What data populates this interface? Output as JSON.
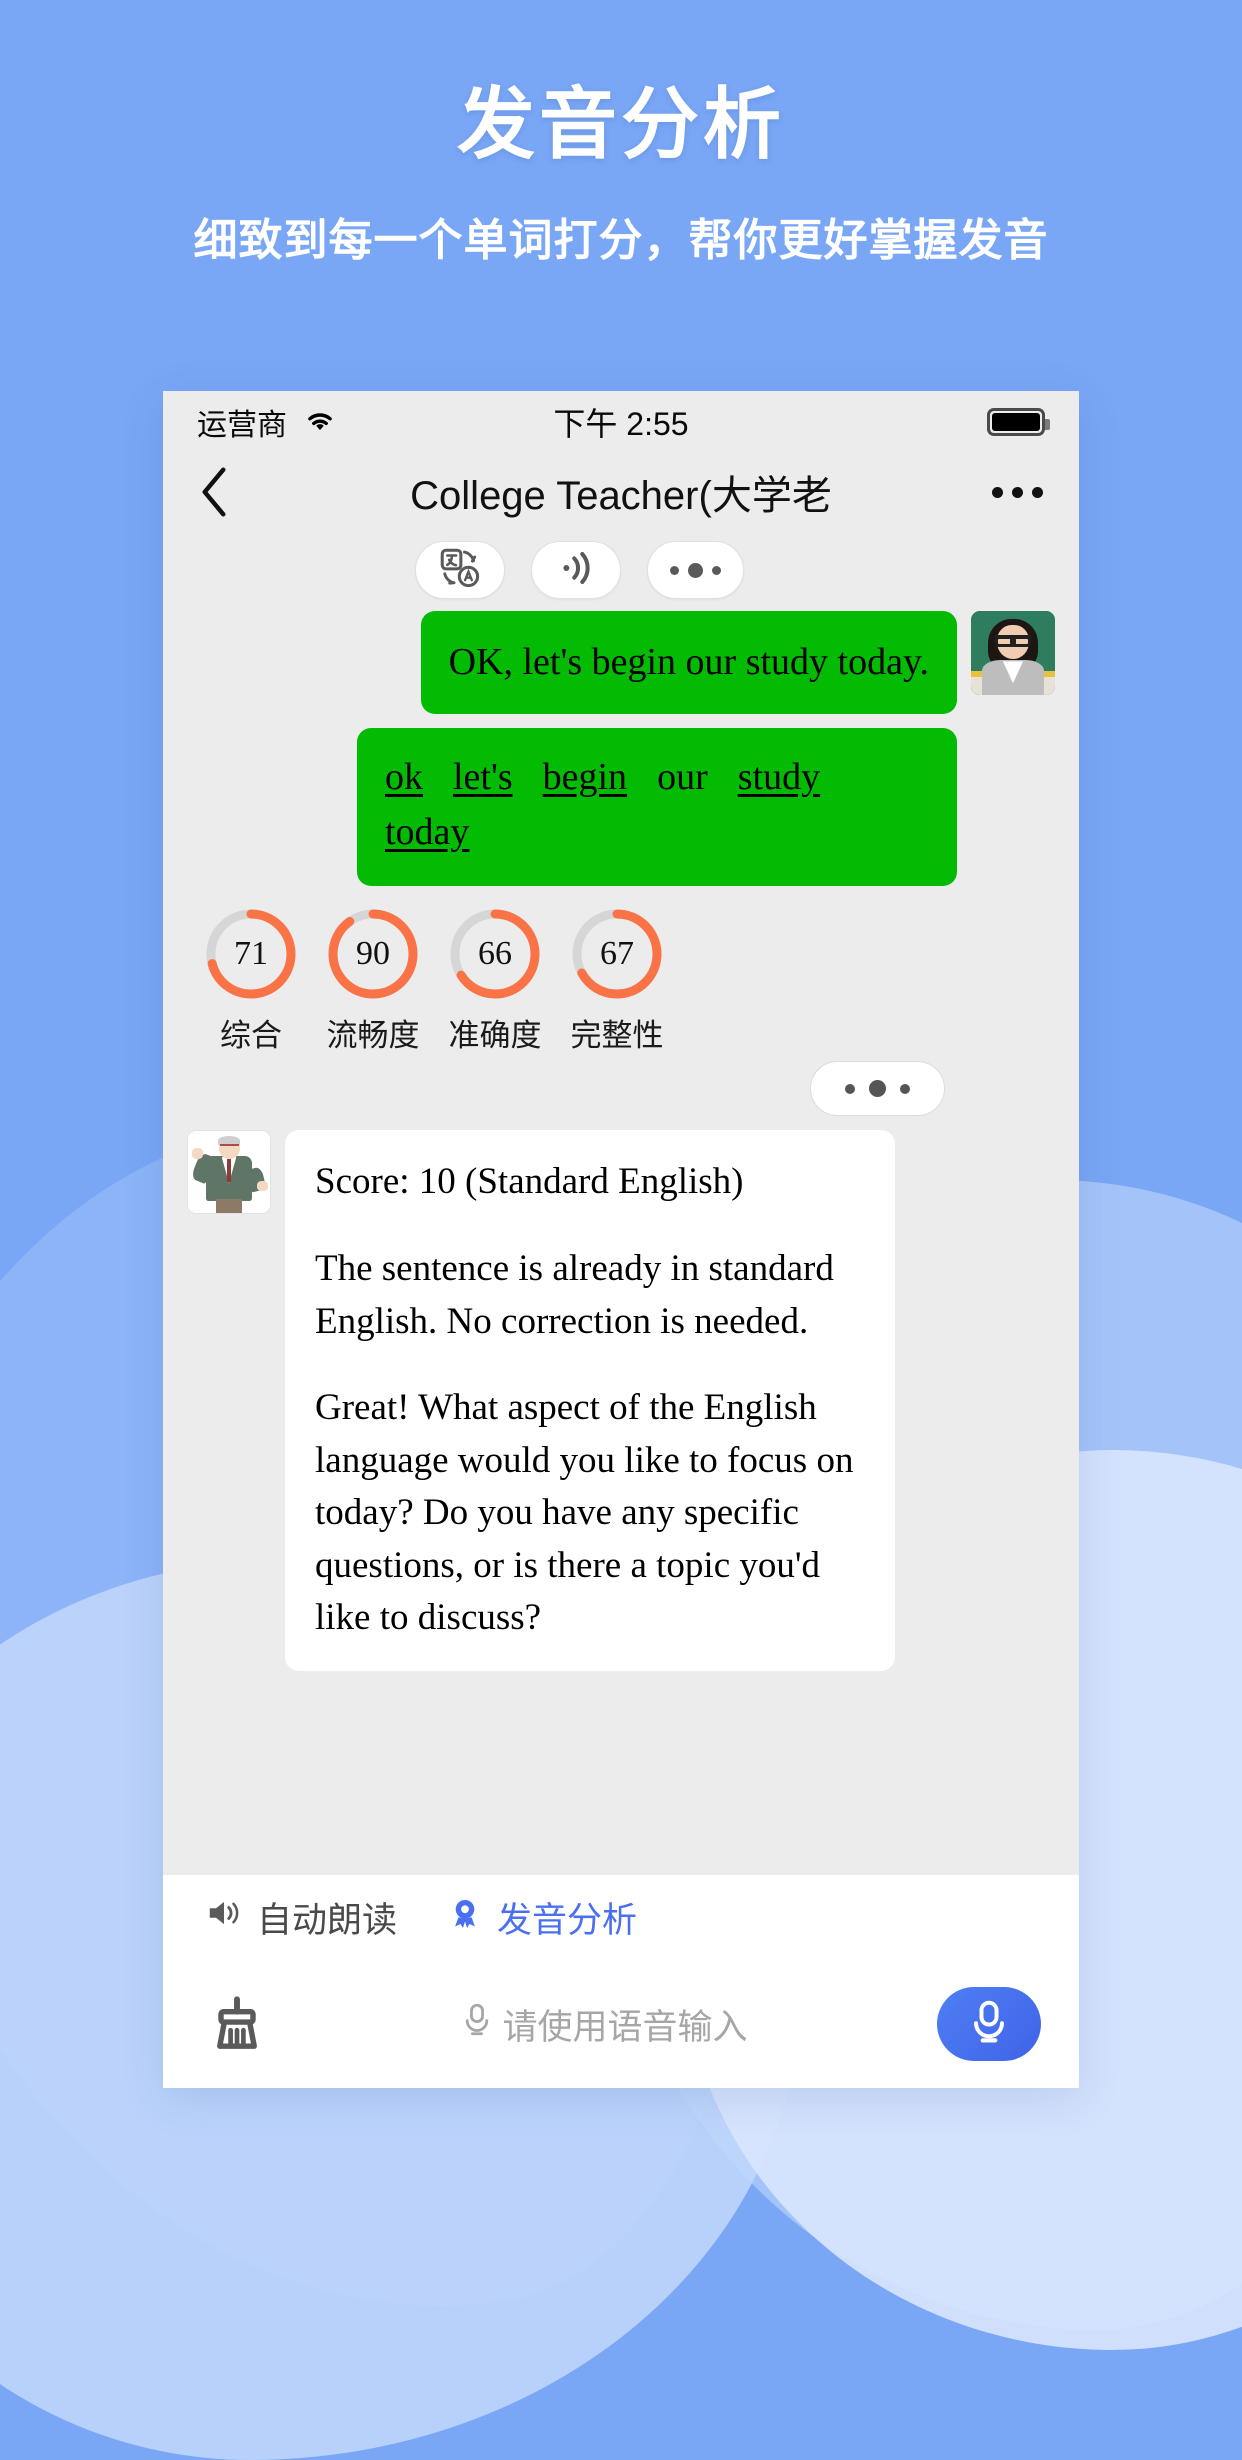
{
  "promo": {
    "title": "发音分析",
    "subtitle": "细致到每一个单词打分，帮你更好掌握发音"
  },
  "statusbar": {
    "carrier": "运营商",
    "wifi_icon": "wifi-icon",
    "time": "下午 2:55",
    "battery_icon": "battery-full-icon"
  },
  "navbar": {
    "back_icon": "chevron-left-icon",
    "title": "College Teacher(大学老",
    "more_icon": "more-horizontal-icon"
  },
  "pills": [
    {
      "icon": "translate-icon",
      "name": "translate-pill"
    },
    {
      "icon": "speaker-wave-icon",
      "name": "read-aloud-pill"
    },
    {
      "icon": "more-dots-icon",
      "name": "more-pill"
    }
  ],
  "chat": {
    "user_message": "OK, let's begin our study today.",
    "user_avatar": "teacher-photo-avatar",
    "words": [
      {
        "text": "ok",
        "underlined": true
      },
      {
        "text": "let's",
        "underlined": true
      },
      {
        "text": "begin",
        "underlined": true
      },
      {
        "text": "our",
        "underlined": false
      },
      {
        "text": "study",
        "underlined": true
      },
      {
        "text": "today",
        "underlined": true
      }
    ],
    "scores": [
      {
        "value": "71",
        "label": "综合"
      },
      {
        "value": "90",
        "label": "流畅度"
      },
      {
        "value": "66",
        "label": "准确度"
      },
      {
        "value": "67",
        "label": "完整性"
      }
    ],
    "typing_indicator": "typing-dots",
    "bot_avatar": "teacher-illustration-avatar",
    "bot_message": [
      "Score: 10 (Standard English)",
      "The sentence is already in standard English. No correction is needed.",
      "Great! What aspect of the English language would you like to focus on today? Do you have any specific questions, or is there a topic you'd like to discuss?"
    ]
  },
  "toolbar": {
    "auto_read_label": "自动朗读",
    "auto_read_icon": "speaker-icon",
    "pron_analysis_label": "发音分析",
    "pron_analysis_icon": "badge-icon"
  },
  "inputbar": {
    "clear_icon": "broom-icon",
    "mic_small_icon": "microphone-icon",
    "placeholder": "请使用语音输入",
    "mic_button_icon": "microphone-icon"
  },
  "colors": {
    "brand_blue": "#79a6f5",
    "bubble_green": "#04bb04",
    "score_orange": "#fa7346",
    "accent_blue": "#4a6ff0"
  }
}
